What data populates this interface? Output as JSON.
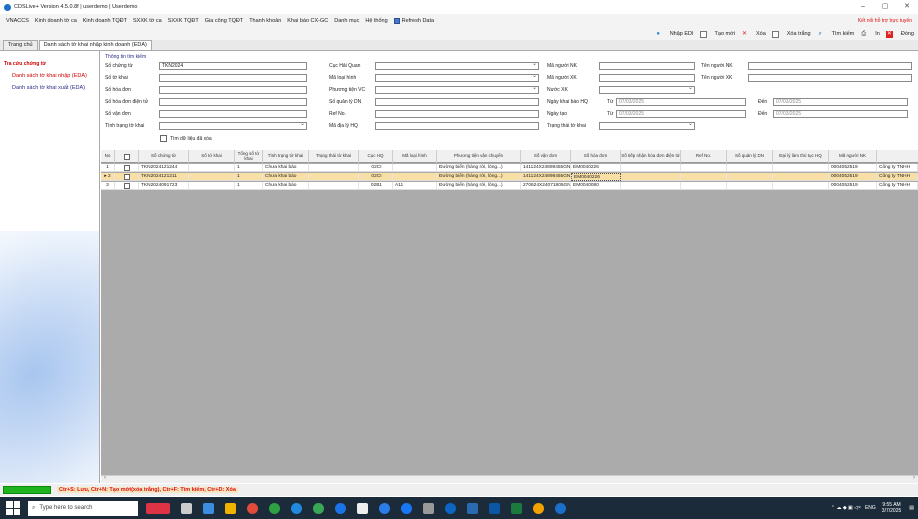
{
  "window": {
    "title": "CDSLive+ Version 4.5.0.8f | userdemo | Userdemo",
    "minimize": "–",
    "restore": "▢",
    "close": "✕"
  },
  "menu": [
    "VNACCS",
    "Kinh doanh tờ ca",
    "Kinh doanh TQĐT",
    "SXXK tờ ca",
    "SXXK TQĐT",
    "Gia công TQĐT",
    "Thanh khoản",
    "Khai báo CX-GC",
    "Danh mục",
    "Hệ thống",
    "Refresh Data"
  ],
  "hotline": "Kết nối hỗ trợ trực tuyến",
  "toolbar": [
    {
      "label": "Nhập EDI",
      "icon": "import-icon"
    },
    {
      "label": "Tạo mới",
      "icon": "new-icon"
    },
    {
      "label": "Xóa",
      "icon": "delete-icon"
    },
    {
      "label": "Xóa trắng",
      "icon": "clear-icon"
    },
    {
      "label": "Tìm kiếm",
      "icon": "search-icon"
    },
    {
      "label": "In",
      "icon": "print-icon"
    },
    {
      "label": "Đóng",
      "icon": "close-icon"
    }
  ],
  "tabs": [
    "Trang chủ",
    "Danh sách tờ khai nhập kinh doanh (EDA)"
  ],
  "sidebar": {
    "group": "Tra cứu chứng từ",
    "items": [
      "Danh sách tờ khai nhập (EDA)",
      "Danh sách tờ khai xuất (EDA)"
    ]
  },
  "form": {
    "section": "Thông tin tìm kiếm",
    "so_chung_tu_label": "Số chứng từ",
    "so_chung_tu_value": "TKN2024",
    "so_to_khai_label": "Số tờ khai",
    "so_hoa_don_label": "Số hóa đơn",
    "so_hddt_label": "Số hóa đơn điện tử",
    "so_van_don_label": "Số vận đơn",
    "tinh_trang_label": "Tình trạng tờ khai",
    "tim_du_lieu_xoa": "Tìm dữ liệu đã xóa",
    "cuc_hq_label": "Cục Hải Quan",
    "ma_loai_hinh_label": "Mã loại hình",
    "phuong_tien_label": "Phương tiện VC",
    "so_quan_ly_label": "Số quản lý DN",
    "ref_no_label": "Ref No.",
    "ma_dia_ly_label": "Mã địa lý HQ",
    "ma_nguoi_nk_label": "Mã người NK",
    "ma_nguoi_xk_label": "Mã người XK",
    "nuoc_xk_label": "Nước XK",
    "ngay_khai_label": "Ngày khai báo HQ",
    "ngay_tao_label": "Ngày tạo",
    "trang_thai_label": "Trạng thái tờ khai",
    "ten_nguoi_nk_label": "Tên người NK",
    "ten_nguoi_xk_label": "Tên người XK",
    "tu_label": "Từ",
    "den_label": "Đến",
    "date_from_1": "07/03/2025",
    "date_to_1": "07/03/2025",
    "date_from_2": "07/03/2025",
    "date_to_2": "07/03/2025"
  },
  "grid": {
    "headers": [
      "No",
      "",
      "Số chứng từ",
      "Số tờ khai",
      "Tổng số tờ khai",
      "Tình trạng tờ khai",
      "Trạng thái tờ khai",
      "Cục HQ",
      "Mã loại hình",
      "Phương tiện vận chuyển",
      "Số vận đơn",
      "Số hóa đơn",
      "Số tiếp nhận hóa đơn điện tử",
      "Ref No.",
      "Số quản lý DN",
      "Đại lý làm thủ tục HQ",
      "Mã người NK",
      ""
    ],
    "rows": [
      {
        "no": "1",
        "so_ct": "TKN2024121244",
        "tong": "1",
        "tinh_trang": "Chưa khai báo",
        "cuc": "02CI",
        "loai": "",
        "ptvc": "Đường biển (hàng rời, lỏng...)",
        "van_don": "141124X24898455GN0",
        "hoa_don": "EM0040226",
        "ma_nk": "0004052519",
        "ten_nk": "Công ty TNHH",
        "selected": false
      },
      {
        "no": "2",
        "so_ct": "TKN2024121211",
        "tong": "1",
        "tinh_trang": "Chưa khai báo",
        "cuc": "02CI",
        "loai": "",
        "ptvc": "Đường biển (hàng rời, lỏng...)",
        "van_don": "141124X24898455GN0",
        "hoa_don": "EM0040226",
        "ma_nk": "0004052519",
        "ten_nk": "Công ty TNHH",
        "selected": true
      },
      {
        "no": "3",
        "so_ct": "TKN2024091723",
        "tong": "1",
        "tinh_trang": "Chưa khai báo",
        "cuc": "02B1",
        "loai": "A11",
        "ptvc": "Đường biển (hàng rời, lỏng...)",
        "van_don": "270624X24071805GN0",
        "hoa_don": "EM0040080",
        "ma_nk": "0004052519",
        "ten_nk": "Công ty TNHH",
        "selected": false
      }
    ]
  },
  "status": {
    "tip": "Ctr+S: Lưu, Ctr+N: Tạo mới(xóa trắng), Ctr+F: Tìm kiếm, Ctr+D: Xóa"
  },
  "taskbar": {
    "search_placeholder": "Type here to search",
    "lang": "ENG",
    "time": "9:55 AM",
    "date": "3/7/2025"
  },
  "colors": {
    "selected_row": "#f8dfa6",
    "tip_red": "#dd1111",
    "taskbar": "#1c2b3a"
  }
}
